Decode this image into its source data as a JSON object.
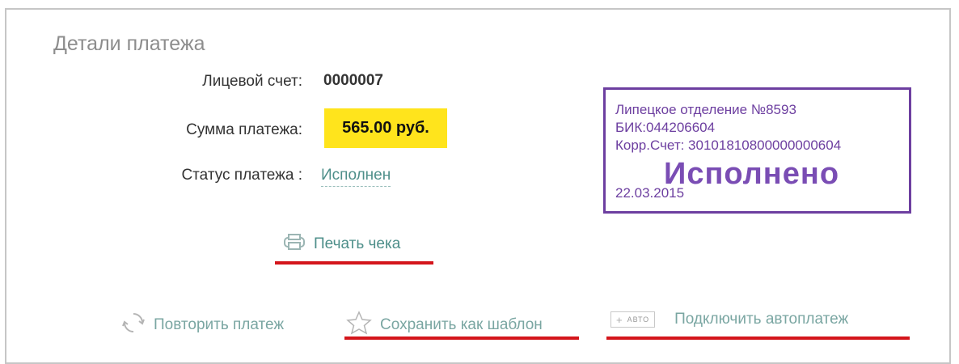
{
  "title": "Детали платежа",
  "fields": {
    "account_label": "Лицевой счет:",
    "account_value": "0000007",
    "amount_label": "Сумма платежа:",
    "amount_value": "565.00 руб.",
    "status_label": "Статус платежа :",
    "status_value": "Исполнен"
  },
  "stamp": {
    "line1": "Липецкое отделение №8593",
    "line2": "БИК:044206604",
    "line3": "Корр.Счет: 30101810800000000604",
    "status": "Исполнено",
    "date": "22.03.2015",
    "color": "#6d3fa0"
  },
  "actions": {
    "print_receipt": "Печать чека",
    "repeat_payment": "Повторить платеж",
    "save_template": "Сохранить как шаблон",
    "auto_badge_plus": "+",
    "auto_badge_text": "АВТО",
    "connect_autopay": "Подключить автоплатеж"
  },
  "colors": {
    "highlight": "#ffe41c",
    "link": "#4e8f8a",
    "underline_marker": "#d4151b"
  }
}
